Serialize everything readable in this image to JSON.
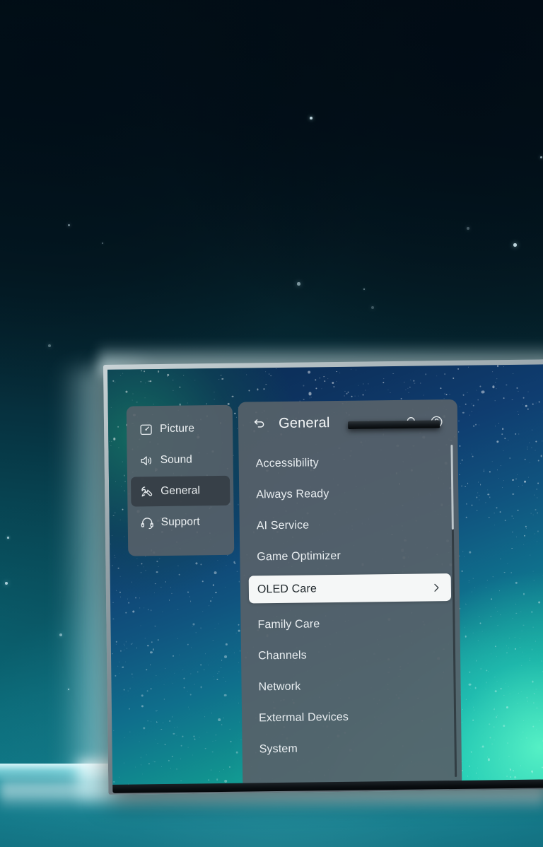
{
  "device": {
    "type": "oled-tv",
    "screen_wallpaper": "starfield-nebula-gradient"
  },
  "colors": {
    "panel_background": "#566169",
    "panel_selected_background": "#f5f7f7",
    "panel_selected_text": "#222a2e",
    "rail_selected_background": "#353e45",
    "text_primary": "#eef2f4",
    "accent_glow": "#bdfbff",
    "screen_top": "#0b2a52",
    "screen_bottom": "#1fd0a4"
  },
  "rail": {
    "items": [
      {
        "label": "Picture",
        "icon": "picture-icon",
        "selected": false
      },
      {
        "label": "Sound",
        "icon": "sound-icon",
        "selected": false
      },
      {
        "label": "General",
        "icon": "wrench-icon",
        "selected": true
      },
      {
        "label": "Support",
        "icon": "headset-icon",
        "selected": false
      }
    ]
  },
  "panel": {
    "back_icon": "back-arrow-icon",
    "title": "General",
    "header_icons": [
      {
        "name": "search-icon"
      },
      {
        "name": "help-icon"
      }
    ],
    "items": [
      {
        "label": "Accessibility",
        "selected": false
      },
      {
        "label": "Always Ready",
        "selected": false
      },
      {
        "label": "AI Service",
        "selected": false
      },
      {
        "label": "Game Optimizer",
        "selected": false
      },
      {
        "label": "OLED Care",
        "selected": true,
        "chevron": "chevron-right-icon"
      },
      {
        "label": "Family Care",
        "selected": false
      },
      {
        "label": "Channels",
        "selected": false
      },
      {
        "label": "Network",
        "selected": false
      },
      {
        "label": "Extermal Devices",
        "selected": false
      },
      {
        "label": "System",
        "selected": false
      }
    ],
    "scrollbar": {
      "visible": true,
      "thumb_position": "top"
    }
  }
}
